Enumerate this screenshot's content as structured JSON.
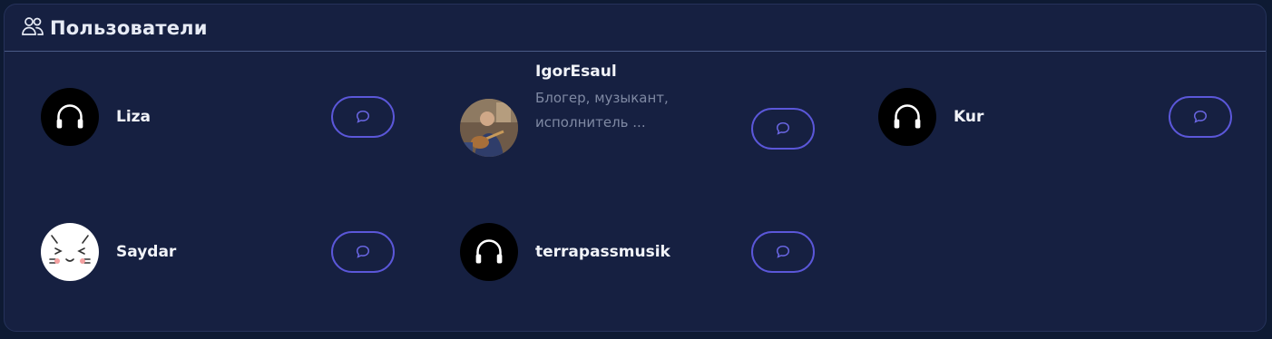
{
  "panel": {
    "title": "Пользователи",
    "icon": "users-icon"
  },
  "users": [
    {
      "name": "Liza",
      "avatar": "headphones-icon",
      "bio": ""
    },
    {
      "name": "IgorEsaul",
      "avatar": "photo-guitarist",
      "bio": "Блогер, музыкант, исполнитель ..."
    },
    {
      "name": "Kur",
      "avatar": "headphones-icon",
      "bio": ""
    },
    {
      "name": "Saydar",
      "avatar": "anime-cat-face",
      "bio": ""
    },
    {
      "name": "terrapassmusik",
      "avatar": "headphones-icon",
      "bio": ""
    }
  ],
  "colors": {
    "page_bg": "#0e1a33",
    "panel_bg": "#162041",
    "accent": "#5b57d9",
    "text": "#f1f3f8",
    "muted": "#7f89a3"
  }
}
